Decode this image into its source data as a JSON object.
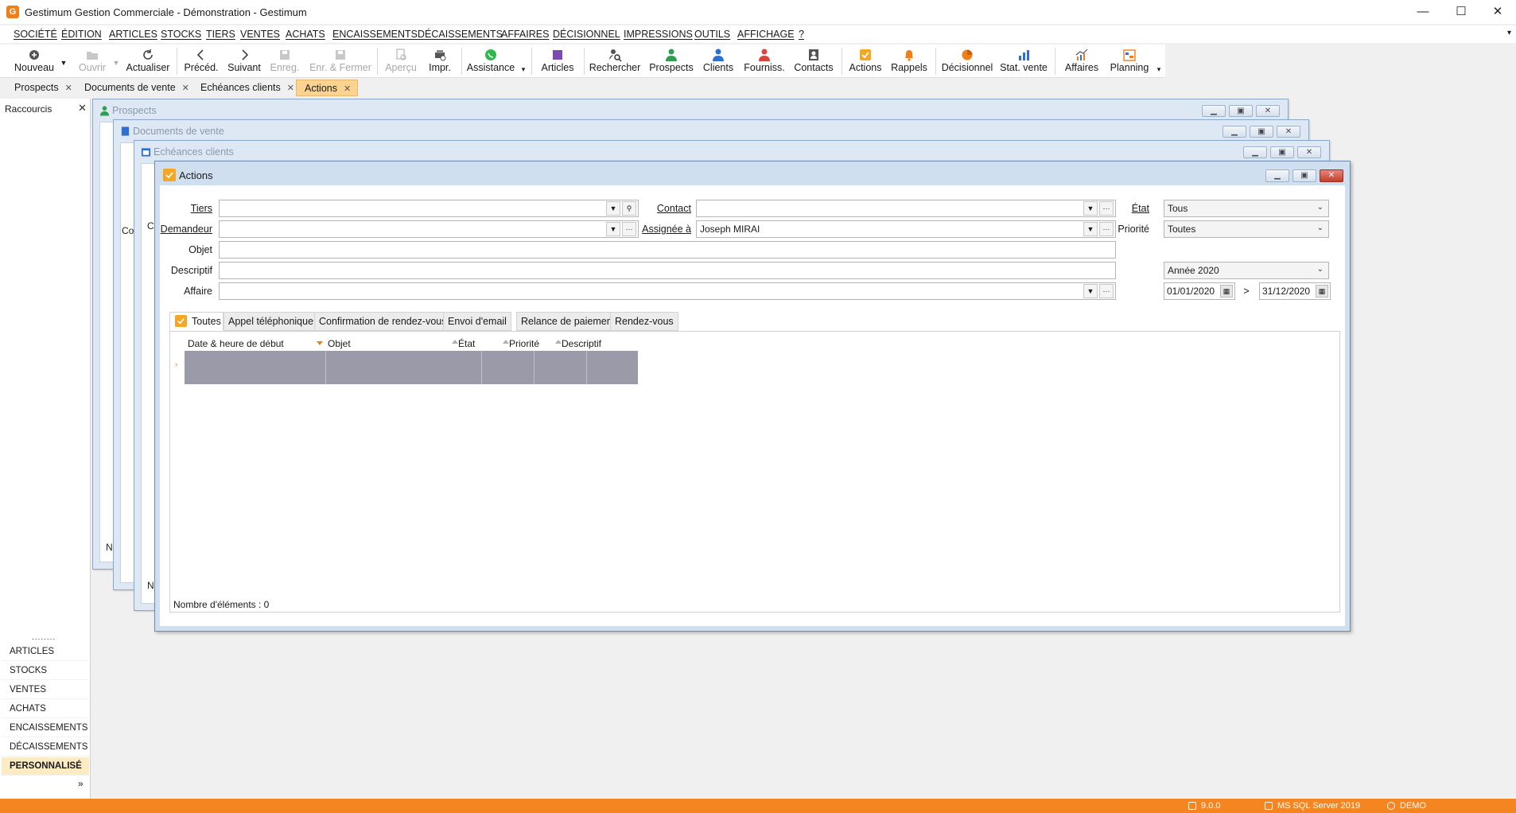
{
  "app": {
    "title": "Gestimum Gestion Commerciale - Démonstration - Gestimum",
    "logo_letter": "G"
  },
  "window_controls": {
    "minimize": "—",
    "maximize": "☐",
    "close": "✕"
  },
  "menu": [
    "SOCIÉTÉ",
    "ÉDITION",
    "ARTICLES",
    "STOCKS",
    "TIERS",
    "VENTES",
    "ACHATS",
    "ENCAISSEMENTS",
    "DÉCAISSEMENTS",
    "AFFAIRES",
    "DÉCISIONNEL",
    "IMPRESSIONS",
    "OUTILS",
    "AFFICHAGE",
    "?"
  ],
  "toolbar": [
    {
      "label": "Nouveau",
      "icon": "plus-circle-icon",
      "enabled": true
    },
    {
      "label": "Ouvrir",
      "icon": "folder-open-icon",
      "enabled": false
    },
    {
      "label": "Actualiser",
      "icon": "refresh-icon",
      "enabled": true
    },
    {
      "label": "Précéd.",
      "icon": "chevron-left-icon",
      "enabled": true
    },
    {
      "label": "Suivant",
      "icon": "chevron-right-icon",
      "enabled": true
    },
    {
      "label": "Enreg.",
      "icon": "save-icon",
      "enabled": false
    },
    {
      "label": "Enr. & Fermer",
      "icon": "save-close-icon",
      "enabled": false
    },
    {
      "label": "Aperçu",
      "icon": "preview-icon",
      "enabled": false
    },
    {
      "label": "Impr.",
      "icon": "print-icon",
      "enabled": true
    },
    {
      "label": "Assistance",
      "icon": "whatsapp-icon",
      "enabled": true
    },
    {
      "label": "Articles",
      "icon": "cube-icon",
      "enabled": true
    },
    {
      "label": "Rechercher",
      "icon": "search-person-icon",
      "enabled": true
    },
    {
      "label": "Prospects",
      "icon": "person-green-icon",
      "enabled": true
    },
    {
      "label": "Clients",
      "icon": "person-blue-icon",
      "enabled": true
    },
    {
      "label": "Fourniss.",
      "icon": "person-red-icon",
      "enabled": true
    },
    {
      "label": "Contacts",
      "icon": "contact-card-icon",
      "enabled": true
    },
    {
      "label": "Actions",
      "icon": "checkbox-orange-icon",
      "enabled": true
    },
    {
      "label": "Rappels",
      "icon": "bell-icon",
      "enabled": true
    },
    {
      "label": "Décisionnel",
      "icon": "pie-chart-icon",
      "enabled": true
    },
    {
      "label": "Stat. vente",
      "icon": "bar-chart-icon",
      "enabled": true
    },
    {
      "label": "Affaires",
      "icon": "trend-chart-icon",
      "enabled": true
    },
    {
      "label": "Planning",
      "icon": "planning-icon",
      "enabled": true
    }
  ],
  "doc_tabs": [
    {
      "label": "Prospects",
      "active": false
    },
    {
      "label": "Documents de vente",
      "active": false
    },
    {
      "label": "Echéances clients",
      "active": false
    },
    {
      "label": "Actions",
      "active": true
    }
  ],
  "sidebar": {
    "header": "Raccourcis",
    "grip": "........",
    "items": [
      "ARTICLES",
      "STOCKS",
      "VENTES",
      "ACHATS",
      "ENCAISSEMENTS",
      "DÉCAISSEMENTS",
      "PERSONNALISÉ"
    ],
    "active_item": "PERSONNALISÉ",
    "more": "»"
  },
  "bg_windows": {
    "prospects": "Prospects",
    "documents": "Documents de vente",
    "echeances": "Echéances clients",
    "fragments": [
      "Co",
      "C",
      "N",
      "N"
    ]
  },
  "actions_window": {
    "title": "Actions",
    "form": {
      "tiers_label": "Tiers",
      "tiers_value": "",
      "demandeur_label": "Demandeur",
      "demandeur_value": "",
      "objet_label": "Objet",
      "objet_value": "",
      "descriptif_label": "Descriptif",
      "descriptif_value": "",
      "affaire_label": "Affaire",
      "affaire_value": "",
      "contact_label": "Contact",
      "contact_value": "",
      "assignee_label": "Assignée à",
      "assignee_value": "Joseph MIRAI",
      "etat_label": "État",
      "etat_value": "Tous",
      "priorite_label": "Priorité",
      "priorite_value": "Toutes",
      "period_value": "Année 2020",
      "date_from": "01/01/2020",
      "date_sep": ">",
      "date_to": "31/12/2020"
    },
    "category_tabs": [
      "Toutes",
      "Appel téléphonique",
      "Confirmation de rendez-vous",
      "Envoi d'email",
      "Relance de paiement",
      "Rendez-vous"
    ],
    "grid": {
      "columns": [
        "Date & heure de début",
        "Objet",
        "État",
        "Priorité",
        "Descriptif"
      ]
    },
    "count_text": "Nombre d'éléments : 0"
  },
  "statusbar": {
    "version": "9.0.0",
    "db": "MS SQL Server 2019",
    "user": "DEMO"
  }
}
